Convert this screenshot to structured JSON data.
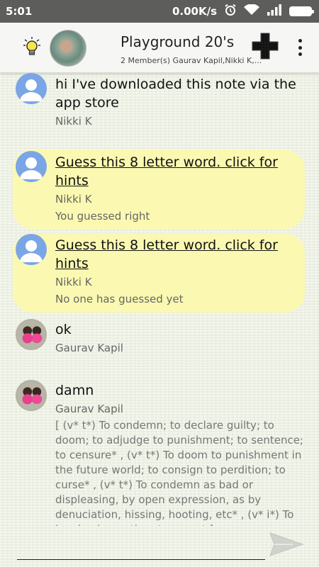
{
  "status_bar": {
    "time": "5:01",
    "net_speed": "0.00K/s"
  },
  "header": {
    "title": "Playground 20's",
    "subtitle": "2 Member(s) Gaurav Kapil,Nikki K,..."
  },
  "messages": [
    {
      "text": "hi I've downloaded this note via the app store",
      "author": "Nikki K"
    },
    {
      "text": "Guess this 8 letter word. click for hints",
      "author": "Nikki K",
      "status": "You guessed right"
    },
    {
      "text": "Guess this 8 letter word. click for hints",
      "author": "Nikki K",
      "status": "No one has guessed yet"
    },
    {
      "text": "ok",
      "author": "Gaurav Kapil"
    },
    {
      "text": "damn",
      "author": "Gaurav Kapil",
      "detail": "[ (v* t*) To condemn; to declare guilty; to doom; to adjudge to punishment; to sentence; to censure* ,  (v* t*) To doom to punishment in the future world; to consign to perdition; to curse* ,  (v* t*) To condemn as bad or displeasing, by open expression, as by denuciation, hissing, hooting, etc* ,  (v* i*) To invoke damnation; to curse* ]"
    }
  ],
  "colors": {
    "status_bar": "#5d5d5b",
    "bubble": "#fbf9b1",
    "default_avatar": "#7aa6e6"
  }
}
